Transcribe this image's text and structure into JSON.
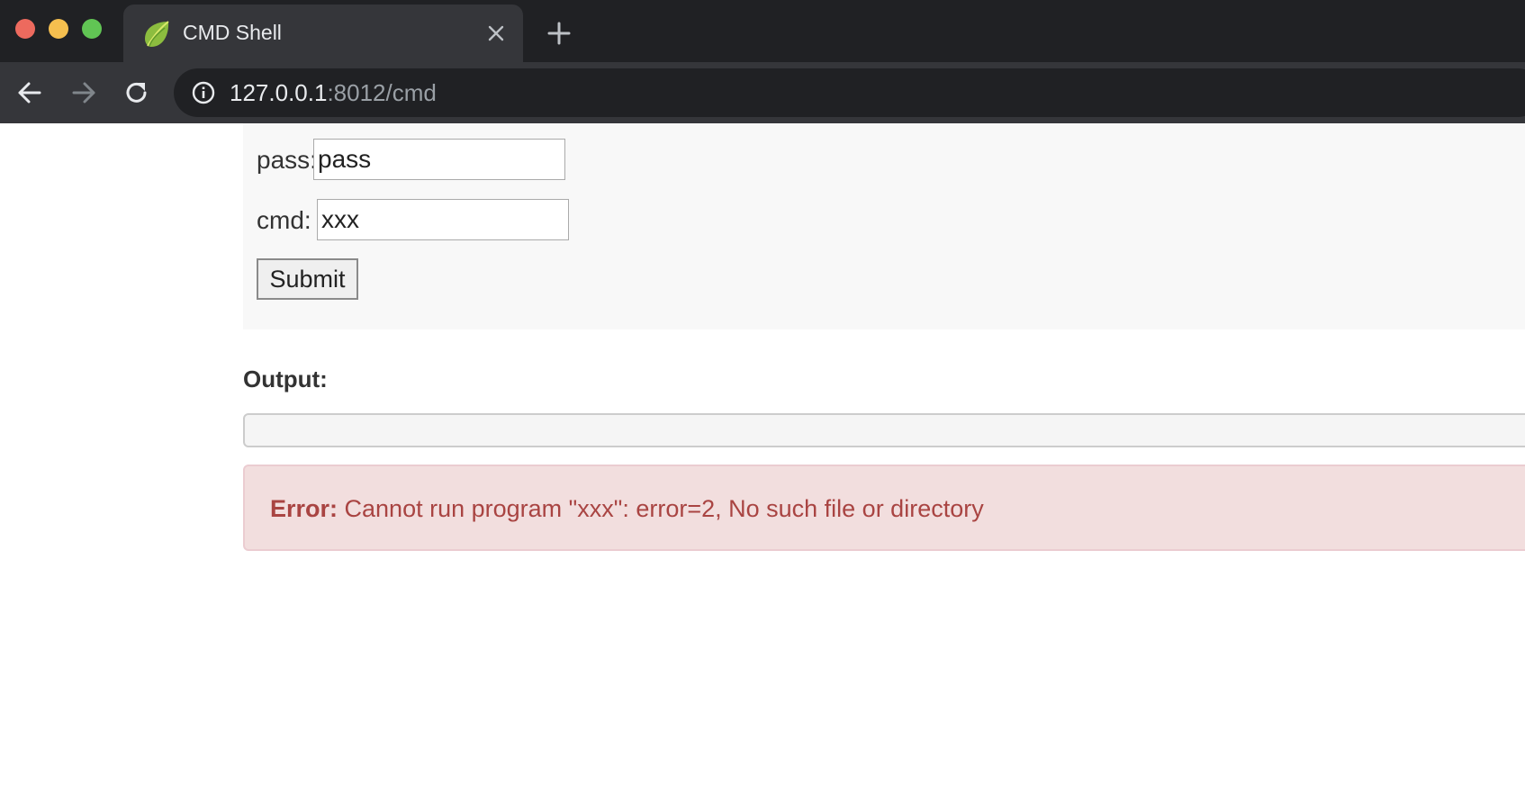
{
  "browser": {
    "tab": {
      "title": "CMD Shell",
      "favicon": "spring-leaf-icon"
    },
    "address_bar": {
      "host": "127.0.0.1",
      "rest": ":8012/cmd"
    }
  },
  "form": {
    "pass_label": "pass:",
    "pass_value": "pass",
    "cmd_label": "cmd:",
    "cmd_value": "xxx",
    "submit_label": "Submit"
  },
  "output": {
    "heading": "Output:",
    "content": ""
  },
  "error": {
    "label": "Error:",
    "message": " Cannot run program \"xxx\": error=2, No such file or directory"
  },
  "colors": {
    "titlebar": "#202124",
    "toolbar": "#35363a",
    "panel_bg": "#f8f8f8",
    "alert_bg": "#f2dede",
    "alert_border": "#ebccd1",
    "alert_text": "#a94442",
    "traffic_close": "#ed6a5e",
    "traffic_minimize": "#f5bf4f",
    "traffic_maximize": "#61c554"
  }
}
